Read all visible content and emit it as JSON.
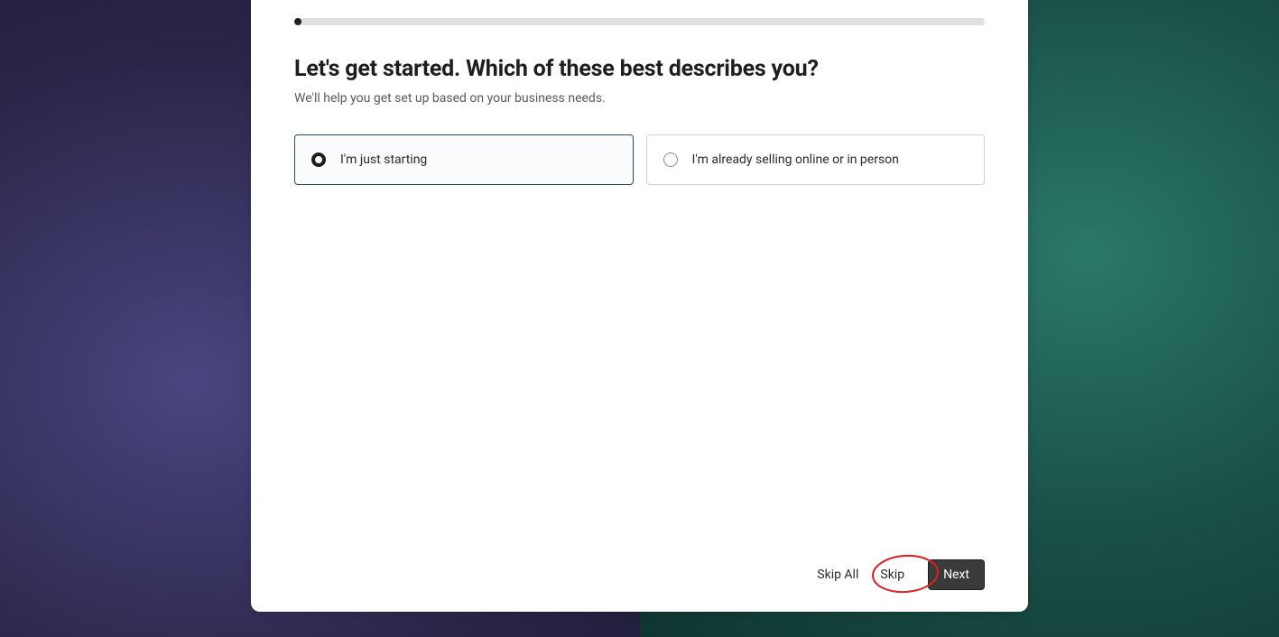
{
  "progress": {
    "percent": 1
  },
  "heading": "Let's get started. Which of these best describes you?",
  "subtitle": "We'll help you get set up based on your business needs.",
  "options": [
    {
      "label": "I'm just starting",
      "selected": true
    },
    {
      "label": "I'm already selling online or in person",
      "selected": false
    }
  ],
  "footer": {
    "skip_all_label": "Skip All",
    "skip_label": "Skip",
    "next_label": "Next"
  }
}
